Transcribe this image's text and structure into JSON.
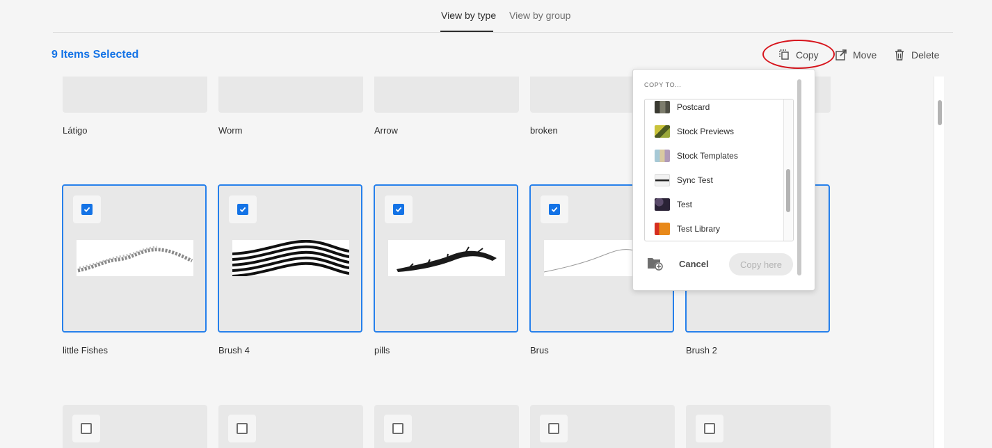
{
  "tabs": [
    {
      "label": "View by type",
      "active": true
    },
    {
      "label": "View by group",
      "active": false
    }
  ],
  "header": {
    "selected_text": "9 Items Selected",
    "actions": {
      "copy": {
        "label": "Copy",
        "icon": "copy-icon"
      },
      "move": {
        "label": "Move",
        "icon": "move-icon"
      },
      "delete": {
        "label": "Delete",
        "icon": "trash-icon"
      }
    }
  },
  "grid": {
    "row1": [
      "Látigo",
      "Worm",
      "Arrow",
      "broken"
    ],
    "row2": [
      {
        "label": "little Fishes",
        "checked": true
      },
      {
        "label": "Brush 4",
        "checked": true
      },
      {
        "label": "pills",
        "checked": true
      },
      {
        "label": "Brus",
        "checked": true
      },
      {
        "label": "Brush 2",
        "checked": true
      }
    ],
    "row3_checked": [
      false,
      false,
      false,
      false,
      false
    ]
  },
  "popover": {
    "title": "COPY TO...",
    "libraries": [
      {
        "label": "Postcard",
        "color": "#6b6b5e"
      },
      {
        "label": "Stock Previews",
        "color": "#9aa83a"
      },
      {
        "label": "Stock Templates",
        "color": "#8fb7c8"
      },
      {
        "label": "Sync Test",
        "color": "#d8d8d8"
      },
      {
        "label": "Test",
        "color": "#2a2236"
      },
      {
        "label": "Test Library",
        "color": "#e8891a"
      }
    ],
    "new_folder_icon": "folder-add-icon",
    "cancel_label": "Cancel",
    "copy_here_label": "Copy here"
  },
  "colors": {
    "accent": "#1473e6",
    "selection_border": "#2680eb",
    "highlight_circle": "#d7141c"
  }
}
